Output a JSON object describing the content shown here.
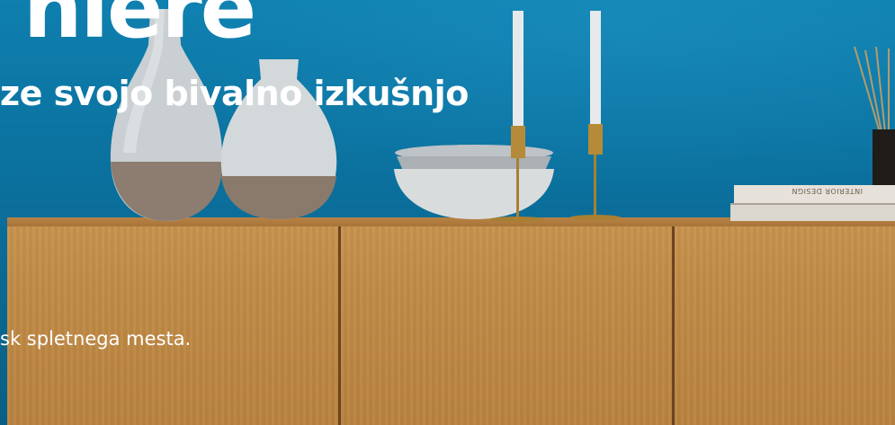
{
  "hero": {
    "headline": "niere",
    "subheadline": "ze svojo bivalno izkušnjo",
    "body": "sk spletnega mesta."
  },
  "decor": {
    "book_spine_text": "INTERIOR DESIGN"
  },
  "colors": {
    "wall": "#0b6f9c",
    "cabinet": "#c28c47",
    "text": "#ffffff"
  }
}
